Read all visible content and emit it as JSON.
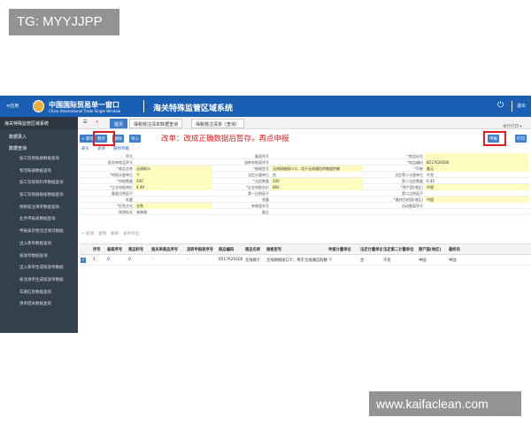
{
  "watermark": {
    "top_left": "TG: MYYJJPP",
    "bottom_right": "www.kaifaclean.com"
  },
  "header": {
    "app_label": "≡应用",
    "title_cn": "中国国际贸易单一窗口",
    "title_en": "China International Trade Single Window",
    "system_title": "海关特殊监管区域系统",
    "logout": "退出"
  },
  "sidebar": {
    "heading": "海关特殊监管区域系统",
    "sections": [
      "数据录入",
      "数据查询"
    ],
    "items": [
      "加工贸易账册数据查询",
      "物流账册数据查询",
      "加工贸易耗料单数据查询",
      "加工贸易册报核数据查询",
      "保税核注清单数据查询",
      "业务申报表数据查询",
      "申报表货物流出情况数据",
      "出入库单数据查询",
      "核放单数据查询",
      "出入库单生成核放单数据",
      "核注清单生成核放单数据",
      "车辆信息数据查询",
      "清单结关数据查询"
    ]
  },
  "tabs": {
    "home": "首页",
    "t1": "保税核注清单数据查询",
    "t2": "保税核注清单（查询）"
  },
  "toolbar": {
    "new": "+ 新增",
    "save": "暂存",
    "delete": "删除",
    "import": "导入",
    "submit": "申报",
    "print": "打印",
    "more": "本行打印 ▾",
    "sub_tabs": [
      "表头",
      "表体",
      "随附单据"
    ]
  },
  "notice": "改单：改成正确数据后暂存，再点申报",
  "form": {
    "rows": [
      [
        [
          "序号",
          ""
        ],
        [
          "备案序号",
          ""
        ],
        [
          "*商品料号",
          ""
        ]
      ],
      [
        [
          "报关单商品序号",
          ""
        ],
        [
          "流转申报表序号",
          ""
        ],
        [
          "*商品编码",
          "8517629200"
        ]
      ],
      [
        [
          "*商品名称",
          "无线网卡"
        ],
        [
          "*规格型号",
          "无线网络接口卡，用于无线通信的数据传输"
        ],
        [
          "*币制",
          "美元"
        ]
      ],
      [
        [
          "*申报计量单位",
          "个"
        ],
        [
          "法定计量单位",
          "台"
        ],
        [
          "法定第二计量单位",
          "千克"
        ]
      ],
      [
        [
          "*申报数量",
          "200"
        ],
        [
          "*法定数量",
          "200"
        ],
        [
          "第二法定数量",
          "0.45"
        ]
      ],
      [
        [
          "*企业申报单价",
          "4.49"
        ],
        [
          "*企业申报总价",
          "892"
        ],
        [
          "*原产国(地区)",
          "中国"
        ]
      ],
      [
        [
          "重量比例因子",
          ""
        ],
        [
          "第一比例因子",
          ""
        ],
        [
          "第二比例因子",
          ""
        ]
      ],
      [
        [
          "毛重",
          ""
        ],
        [
          "净重",
          ""
        ],
        [
          "*最终目的国(地区)",
          "中国"
        ]
      ],
      [
        [
          "*征免方式",
          "全免"
        ],
        [
          "单耗版本号",
          ""
        ],
        [
          "自动备案序号",
          ""
        ]
      ],
      [
        [
          "修改标志",
          "未修改"
        ],
        [
          "备注",
          ""
        ],
        [
          "",
          ""
        ]
      ]
    ]
  },
  "grid_actions": [
    "+ 新增",
    "复制",
    "删除",
    "表体导出"
  ],
  "grid": {
    "headers": [
      "序号",
      "备案序号",
      "商品料号",
      "报关单商品序号",
      "流转申报表序号",
      "商品编码",
      "商品名称",
      "规格型号",
      "申报计量单位",
      "法定计量单位",
      "法定第二计量单位",
      "原产国(地区)",
      "最终目"
    ],
    "rows": [
      [
        "1",
        "0",
        "0",
        "-",
        "-",
        "8517629200",
        "无线网卡",
        "无线网络接口卡，用于无线通信的数据传输",
        "个",
        "台",
        "千克",
        "中国",
        "中国"
      ]
    ]
  }
}
